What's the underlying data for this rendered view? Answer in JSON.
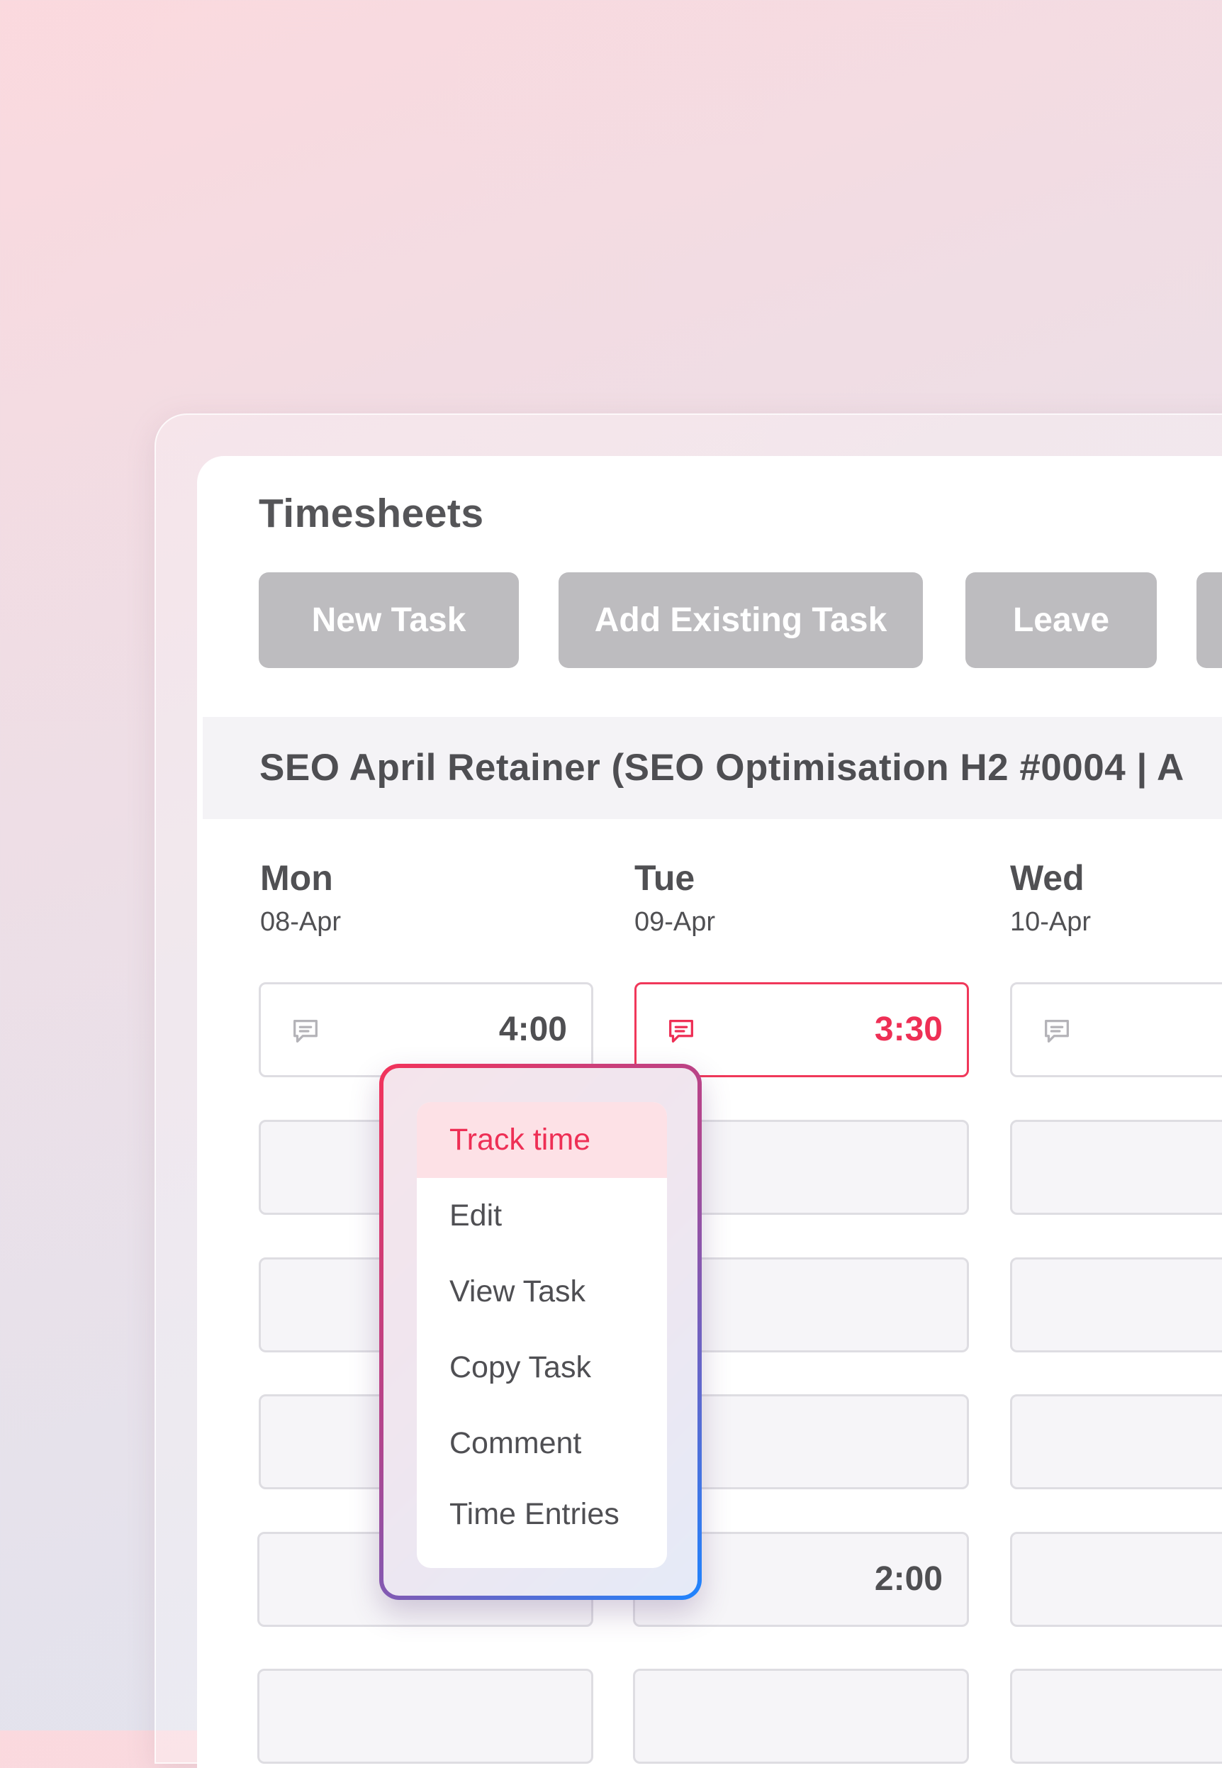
{
  "page": {
    "title": "Timesheets"
  },
  "toolbar": {
    "new_task": "New Task",
    "add_existing_task": "Add Existing Task",
    "leave": "Leave"
  },
  "project": {
    "name": "SEO April Retainer (SEO Optimisation H2 #0004 | A"
  },
  "days": [
    {
      "name": "Mon",
      "date": "08-Apr"
    },
    {
      "name": "Tue",
      "date": "09-Apr"
    },
    {
      "name": "Wed",
      "date": "10-Apr"
    }
  ],
  "entries": {
    "mon_row1": "4:00",
    "tue_row1": "3:30",
    "tue_row5": "2:00"
  },
  "context_menu": {
    "items": [
      "Track time",
      "Edit",
      "View Task",
      "Copy Task",
      "Comment",
      "Time Entries"
    ],
    "highlighted": "Track time"
  },
  "colors": {
    "accent": "#ee2f55",
    "button_bg": "#bdbcbf",
    "menu_gradient_start": "#f2335a",
    "menu_gradient_end": "#1e84ff"
  },
  "icons": {
    "cell_comment": "comment-icon"
  }
}
